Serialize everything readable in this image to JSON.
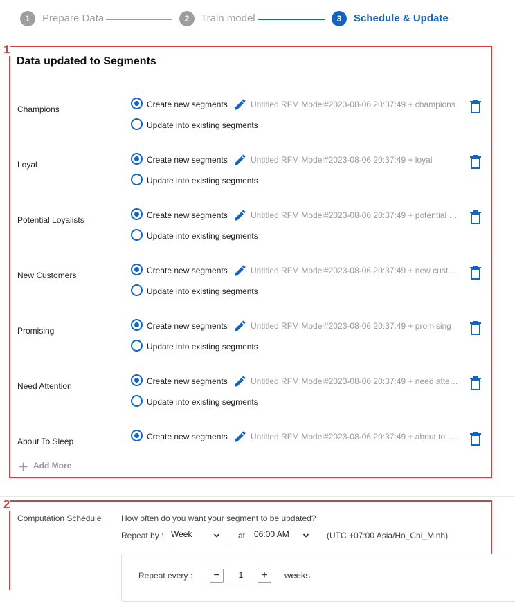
{
  "stepper": {
    "steps": [
      {
        "number": "1",
        "label": "Prepare Data",
        "state": "inactive"
      },
      {
        "number": "2",
        "label": "Train model",
        "state": "inactive"
      },
      {
        "number": "3",
        "label": "Schedule & Update",
        "state": "active"
      }
    ]
  },
  "annotations": {
    "box1": "1",
    "box2": "2"
  },
  "segments_section": {
    "title": "Data updated to Segments",
    "create_label": "Create new segments",
    "update_label": "Update into existing segments",
    "rows": [
      {
        "name": "Champions",
        "default_name": "Untitled RFM Model#2023-08-06 20:37:49 + champions",
        "selected": "create"
      },
      {
        "name": "Loyal",
        "default_name": "Untitled RFM Model#2023-08-06 20:37:49 + loyal",
        "selected": "create"
      },
      {
        "name": "Potential Loyalists",
        "default_name": "Untitled RFM Model#2023-08-06 20:37:49 + potential loyalists",
        "selected": "create"
      },
      {
        "name": "New Customers",
        "default_name": "Untitled RFM Model#2023-08-06 20:37:49 + new customers",
        "selected": "create"
      },
      {
        "name": "Promising",
        "default_name": "Untitled RFM Model#2023-08-06 20:37:49 + promising",
        "selected": "create"
      },
      {
        "name": "Need Attention",
        "default_name": "Untitled RFM Model#2023-08-06 20:37:49 + need attention",
        "selected": "create"
      },
      {
        "name": "About To Sleep",
        "default_name": "Untitled RFM Model#2023-08-06 20:37:49 + about to sleep",
        "selected": "create"
      }
    ],
    "add_more_label": "Add More"
  },
  "schedule": {
    "label": "Computation Schedule",
    "question": "How often do you want your segment to be updated?",
    "repeat_by_label": "Repeat by :",
    "repeat_by_value": "Week",
    "at_label": "at",
    "time_value": "06:00 AM",
    "timezone": "(UTC +07:00 Asia/Ho_Chi_Minh)",
    "repeat_every_label": "Repeat every :",
    "decrement": "−",
    "repeat_every_value": "1",
    "increment": "+",
    "unit": "weeks"
  },
  "colors": {
    "accent": "#1565c0",
    "inactive": "#9e9e9e",
    "annotation": "#e53935"
  },
  "icons": [
    "pencil-icon",
    "trash-icon",
    "plus-icon",
    "chevron-down-icon"
  ]
}
